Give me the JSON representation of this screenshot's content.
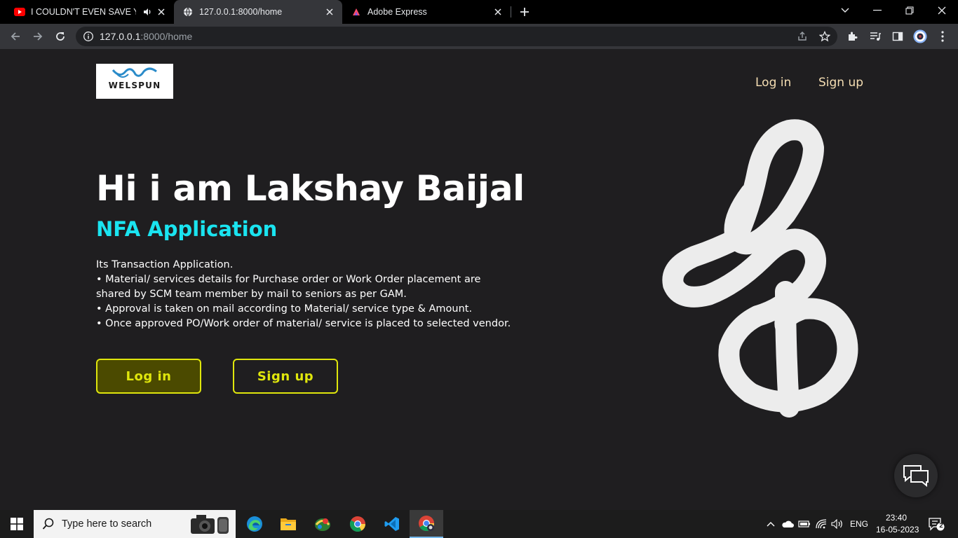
{
  "browser": {
    "tabs": [
      {
        "title": "I COULDN'T EVEN SAVE YOU",
        "favicon": "youtube-icon",
        "audio": true,
        "active": false
      },
      {
        "title": "127.0.0.1:8000/home",
        "favicon": "globe-icon",
        "active": true
      },
      {
        "title": "Adobe Express",
        "favicon": "adobe-express-icon",
        "active": false
      }
    ],
    "url": {
      "host": "127.0.0.1",
      "path": ":8000/home"
    }
  },
  "header": {
    "logo_text": "WELSPUN",
    "nav": {
      "login": "Log in",
      "signup": "Sign up"
    }
  },
  "hero": {
    "title": "Hi i am Lakshay Baijal",
    "subtitle": "NFA Application",
    "description": [
      "Its Transaction Application.",
      "• Material/ services details for Purchase order or Work Order placement are shared by SCM team member by mail to seniors as per GAM.",
      "• Approval is taken on mail according to Material/ service type & Amount.",
      "• Once approved PO/Work order of material/ service is placed to selected vendor."
    ],
    "buttons": {
      "login": "Log in",
      "signup": "Sign up"
    }
  },
  "colors": {
    "page_bg": "#1f1e20",
    "nav_link": "#f5deb3",
    "subtitle": "#1ae4f0",
    "button_accent": "#dfe60c",
    "button_fill": "#4b4a00"
  },
  "taskbar": {
    "search_placeholder": "Type here to search",
    "lang": "ENG",
    "time": "23:40",
    "date": "16-05-2023",
    "notification_count": "2",
    "apps": [
      "edge-icon",
      "file-explorer-icon",
      "app-icon",
      "chrome-icon",
      "vscode-icon",
      "chrome-active-icon"
    ]
  }
}
